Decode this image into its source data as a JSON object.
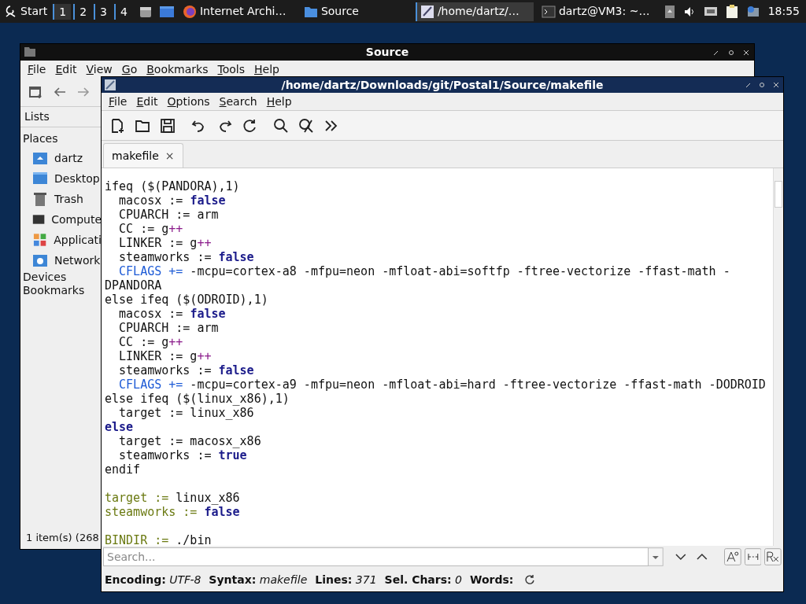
{
  "taskbar": {
    "start": "Start",
    "workspaces": [
      {
        "label": "1",
        "selected": true
      },
      {
        "label": "2",
        "selected": false
      },
      {
        "label": "3",
        "selected": false
      },
      {
        "label": "4",
        "selected": false
      }
    ],
    "tasks": [
      {
        "kind": "browser",
        "label": "Internet Archi…",
        "selected": false
      },
      {
        "kind": "folder",
        "label": "Source",
        "selected": false
      },
      {
        "kind": "editor",
        "label": "/home/dartz/…",
        "selected": true
      },
      {
        "kind": "terminal",
        "label": "dartz@VM3: ~…",
        "selected": false
      }
    ],
    "clock": "18:55"
  },
  "file_manager": {
    "title": "Source",
    "menu": [
      "File",
      "Edit",
      "View",
      "Go",
      "Bookmarks",
      "Tools",
      "Help"
    ],
    "side_tab": "Lists",
    "places_heading": "Places",
    "places": [
      {
        "kind": "home",
        "label": "dartz"
      },
      {
        "kind": "desktop",
        "label": "Desktop"
      },
      {
        "kind": "trash",
        "label": "Trash"
      },
      {
        "kind": "computer",
        "label": "Compute"
      },
      {
        "kind": "apps",
        "label": "Applicati"
      },
      {
        "kind": "network",
        "label": "Network"
      }
    ],
    "devices_heading": "Devices",
    "bookmarks_heading": "Bookmarks",
    "status": "1 item(s) (268"
  },
  "editor": {
    "title": "/home/dartz/Downloads/git/Postal1/Source/makefile",
    "menu": [
      "File",
      "Edit",
      "Options",
      "Search",
      "Help"
    ],
    "tab": {
      "label": "makefile",
      "close": "×"
    },
    "lines": [
      {
        "kind": "code",
        "segments": [
          {
            "text": "ifeq ($(PANDORA),1)",
            "kind": "plain"
          }
        ]
      },
      {
        "kind": "code",
        "segments": [
          {
            "text": "  macosx := ",
            "kind": "plain"
          },
          {
            "text": "false",
            "kind": "keyword"
          }
        ]
      },
      {
        "kind": "code",
        "segments": [
          {
            "text": "  CPUARCH := arm",
            "kind": "plain"
          }
        ]
      },
      {
        "kind": "code",
        "segments": [
          {
            "text": "  CC := g",
            "kind": "plain"
          },
          {
            "text": "++",
            "kind": "operator"
          }
        ]
      },
      {
        "kind": "code",
        "segments": [
          {
            "text": "  LINKER := g",
            "kind": "plain"
          },
          {
            "text": "++",
            "kind": "operator"
          }
        ]
      },
      {
        "kind": "code",
        "segments": [
          {
            "text": "  steamworks := ",
            "kind": "plain"
          },
          {
            "text": "false",
            "kind": "keyword"
          }
        ]
      },
      {
        "kind": "code",
        "segments": [
          {
            "text": "  CFLAGS +=",
            "kind": "variable"
          },
          {
            "text": " -mcpu=cortex-a8 -mfpu=neon -mfloat-abi=softfp -ftree-vectorize -ffast-math -",
            "kind": "plain"
          }
        ]
      },
      {
        "kind": "code",
        "segments": [
          {
            "text": "DPANDORA",
            "kind": "plain"
          }
        ]
      },
      {
        "kind": "code",
        "segments": [
          {
            "text": "else ifeq ($(ODROID),1)",
            "kind": "plain"
          }
        ]
      },
      {
        "kind": "code",
        "segments": [
          {
            "text": "  macosx := ",
            "kind": "plain"
          },
          {
            "text": "false",
            "kind": "keyword"
          }
        ]
      },
      {
        "kind": "code",
        "segments": [
          {
            "text": "  CPUARCH := arm",
            "kind": "plain"
          }
        ]
      },
      {
        "kind": "code",
        "segments": [
          {
            "text": "  CC := g",
            "kind": "plain"
          },
          {
            "text": "++",
            "kind": "operator"
          }
        ]
      },
      {
        "kind": "code",
        "segments": [
          {
            "text": "  LINKER := g",
            "kind": "plain"
          },
          {
            "text": "++",
            "kind": "operator"
          }
        ]
      },
      {
        "kind": "code",
        "segments": [
          {
            "text": "  steamworks := ",
            "kind": "plain"
          },
          {
            "text": "false",
            "kind": "keyword"
          }
        ]
      },
      {
        "kind": "code",
        "segments": [
          {
            "text": "  CFLAGS +=",
            "kind": "variable"
          },
          {
            "text": " -mcpu=cortex-a9 -mfpu=neon -mfloat-abi=hard -ftree-vectorize -ffast-math -DODROID",
            "kind": "plain"
          }
        ]
      },
      {
        "kind": "code",
        "segments": [
          {
            "text": "else ifeq ($(linux_x86),1)",
            "kind": "plain"
          }
        ]
      },
      {
        "kind": "code",
        "segments": [
          {
            "text": "  target := linux_x86",
            "kind": "plain"
          }
        ]
      },
      {
        "kind": "code",
        "segments": [
          {
            "text": "else",
            "kind": "keyword"
          }
        ]
      },
      {
        "kind": "code",
        "segments": [
          {
            "text": "  target := macosx_x86",
            "kind": "plain"
          }
        ]
      },
      {
        "kind": "code",
        "segments": [
          {
            "text": "  steamworks := ",
            "kind": "plain"
          },
          {
            "text": "true",
            "kind": "keyword"
          }
        ]
      },
      {
        "kind": "code",
        "segments": [
          {
            "text": "endif",
            "kind": "plain"
          }
        ]
      },
      {
        "kind": "blank"
      },
      {
        "kind": "code",
        "segments": [
          {
            "text": "target :=",
            "kind": "assign"
          },
          {
            "text": " linux_x86",
            "kind": "plain"
          }
        ]
      },
      {
        "kind": "code",
        "segments": [
          {
            "text": "steamworks := ",
            "kind": "assign"
          },
          {
            "text": "false",
            "kind": "keyword"
          }
        ]
      },
      {
        "kind": "blank"
      },
      {
        "kind": "code",
        "segments": [
          {
            "text": "BINDIR :=",
            "kind": "assign"
          },
          {
            "text": " ./bin",
            "kind": "plain"
          }
        ]
      }
    ],
    "search": {
      "placeholder": "Search..."
    },
    "status": [
      {
        "label": "Encoding:",
        "value": "UTF-8"
      },
      {
        "label": "Syntax:",
        "value": "makefile"
      },
      {
        "label": "Lines:",
        "value": "371"
      },
      {
        "label": "Sel. Chars:",
        "value": "0"
      },
      {
        "label": "Words:"
      }
    ]
  }
}
